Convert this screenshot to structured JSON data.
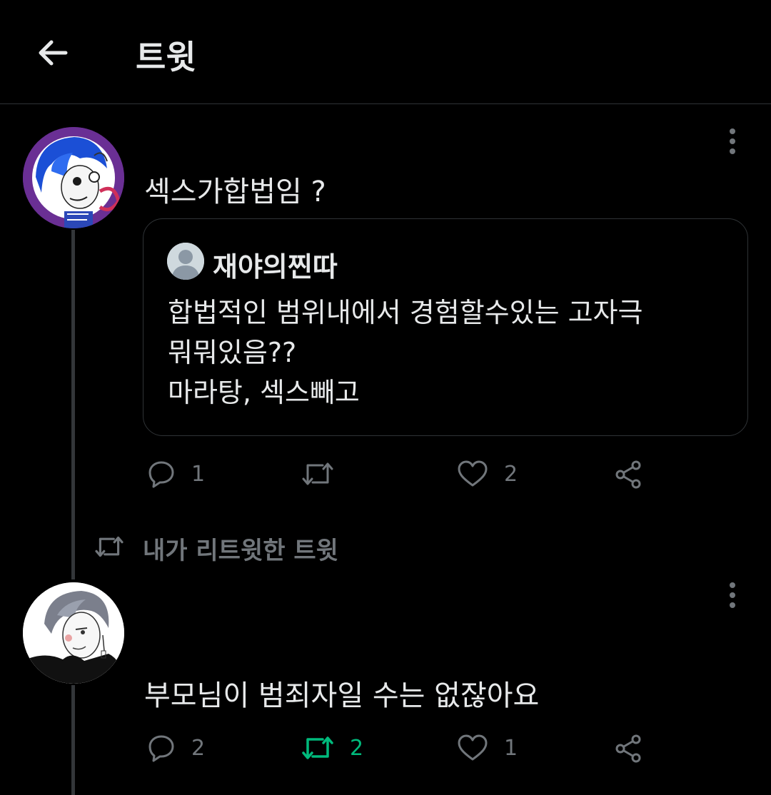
{
  "header": {
    "title": "트윗"
  },
  "tweet1": {
    "text": "섹스가합법임 ?",
    "quote": {
      "name": "재야의찐따",
      "lines": [
        "합법적인 범위내에서 경험할수있는 고자극",
        "뭐뭐있음??",
        "마라탕, 섹스빼고"
      ]
    },
    "actions": {
      "replies": "1",
      "retweets": "",
      "likes": "2"
    }
  },
  "retweet_context": {
    "label": "내가 리트윗한 트윗"
  },
  "tweet2": {
    "text": "부모님이 범죄자일 수는 없잖아요",
    "actions": {
      "replies": "2",
      "retweets": "2",
      "likes": "1"
    }
  },
  "colors": {
    "background": "#000000",
    "text": "#e7e9ea",
    "muted": "#71767b",
    "retweet_active": "#00ba7c",
    "border": "#2f3336"
  },
  "icons": [
    "back-arrow-icon",
    "more-vertical-icon",
    "reply-icon",
    "retweet-icon",
    "like-icon",
    "share-icon"
  ]
}
